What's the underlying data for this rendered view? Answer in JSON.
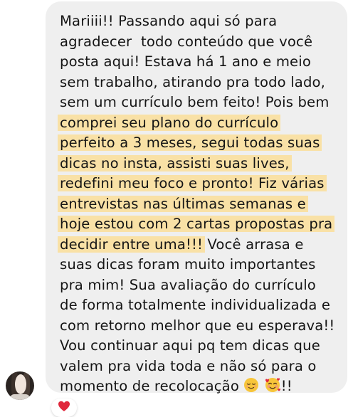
{
  "message": {
    "segments": [
      {
        "text": "Mariiii!! Passando aqui só para\nagradecer  todo conteúdo que você\nposta aqui! Estava há 1 ano e meio\nsem trabalho, atirando pra todo lado,\nsem um currículo bem feito! Pois bem\n",
        "highlight": false
      },
      {
        "text": "comprei seu plano do currículo\nperfeito a 3 meses, segui todas suas\ndicas no insta, assisti suas lives,\nredefini meu foco e pronto! Fiz várias\nentrevistas nas últimas semanas e\nhoje estou com 2 cartas propostas pra\ndecidir entre uma!!!",
        "highlight": true
      },
      {
        "text": " Você arrasa e\nsuas dicas foram muito importantes\npra mim! Sua avaliação do currículo\nde forma totalmente individualizada e\ncom retorno melhor que eu esperava!!\nVou continuar aqui pq tem dicas que\nvalem pra vida toda e não só para o\nmomento de recolocação ",
        "highlight": false
      }
    ],
    "trailing_emojis": [
      "relieved-face",
      "smiling-face-with-hearts"
    ],
    "trailing_text": "!!"
  },
  "reaction": {
    "icon": "red-heart-icon"
  },
  "colors": {
    "bubble": "#efefef",
    "highlight": "#f9e1a6",
    "text": "#151515",
    "heart": "#e0283c"
  }
}
